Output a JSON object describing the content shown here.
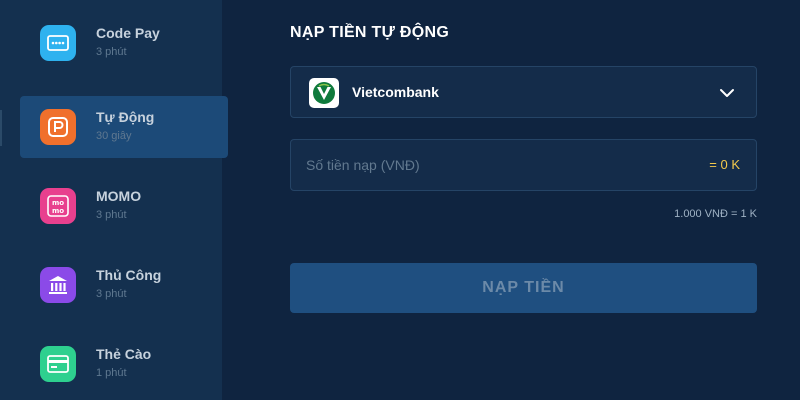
{
  "sidebar": {
    "items": [
      {
        "title": "Code Pay",
        "sub": "3 phút",
        "icon": "keypad-icon",
        "color": "#2eb2ef"
      },
      {
        "title": "Tự Động",
        "sub": "30 giây",
        "icon": "p-logo-icon",
        "color": "#f0702c"
      },
      {
        "title": "MOMO",
        "sub": "3 phút",
        "icon": "momo-icon",
        "color": "#e8408e"
      },
      {
        "title": "Thủ Công",
        "sub": "3 phút",
        "icon": "bank-icon",
        "color": "#8b4ae8"
      },
      {
        "title": "Thẻ Cào",
        "sub": "1 phút",
        "icon": "card-icon",
        "color": "#2ed08f"
      }
    ]
  },
  "main": {
    "heading": "NẠP TIỀN TỰ ĐỘNG",
    "bank": {
      "name": "Vietcombank",
      "logo": "vietcombank-logo"
    },
    "amount": {
      "placeholder": "Số tiền nạp (VNĐ)",
      "value": "",
      "converted": "= 0 K"
    },
    "rate": "1.000 VNĐ = 1 K",
    "submit_label": "NẠP TIỀN"
  }
}
